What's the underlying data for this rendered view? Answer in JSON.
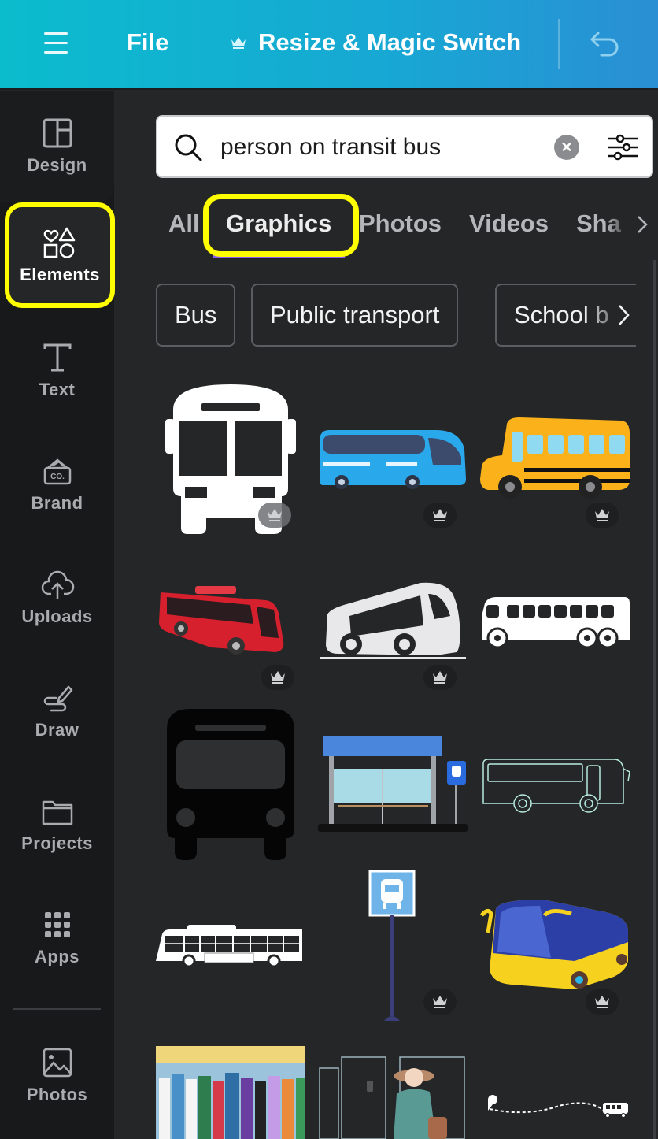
{
  "topbar": {
    "menu_icon": "hamburger-icon",
    "file_label": "File",
    "resize_label": "Resize & Magic Switch",
    "resize_icon": "crown-icon",
    "undo_icon": "undo-icon",
    "gradient_start": "#0bbccd",
    "gradient_end": "#2a8fd4"
  },
  "sidebar": {
    "active": "Elements",
    "highlight_color": "#ffff00",
    "items": [
      {
        "label": "Design",
        "icon": "layout-icon"
      },
      {
        "label": "Elements",
        "icon": "shapes-icon"
      },
      {
        "label": "Text",
        "icon": "text-icon"
      },
      {
        "label": "Brand",
        "icon": "brand-icon"
      },
      {
        "label": "Uploads",
        "icon": "cloud-upload-icon"
      },
      {
        "label": "Draw",
        "icon": "pen-icon"
      },
      {
        "label": "Projects",
        "icon": "folder-icon"
      },
      {
        "label": "Apps",
        "icon": "apps-grid-icon"
      },
      {
        "label": "Photos",
        "icon": "image-icon"
      }
    ]
  },
  "search": {
    "value": "person on transit bus",
    "search_icon": "search-icon",
    "clear_icon": "clear-icon",
    "filter_icon": "filter-sliders-icon"
  },
  "tabs": {
    "active": "Graphics",
    "items": [
      "All",
      "Graphics",
      "Photos",
      "Videos",
      "Shapes"
    ],
    "visible_text": [
      "All",
      "Graphics",
      "Photos",
      "Videos",
      "Sha"
    ]
  },
  "chips": {
    "items": [
      "Bus",
      "Public transport",
      "School bus"
    ],
    "visible_text": [
      "Bus",
      "Public transport",
      "School b"
    ]
  },
  "results": [
    {
      "name": "white-bus-front-silhouette",
      "premium": true
    },
    {
      "name": "blue-coach-bus",
      "premium": true
    },
    {
      "name": "yellow-school-bus",
      "premium": true
    },
    {
      "name": "red-coach-bus",
      "premium": true
    },
    {
      "name": "white-bus-logo-sketch",
      "premium": true
    },
    {
      "name": "white-bus-side-icon",
      "premium": false
    },
    {
      "name": "black-bus-front-icon",
      "premium": false
    },
    {
      "name": "bus-stop-shelter",
      "premium": false
    },
    {
      "name": "bus-outline-line-art",
      "premium": false
    },
    {
      "name": "white-city-bus-side",
      "premium": false
    },
    {
      "name": "bus-stop-sign-pole",
      "premium": true
    },
    {
      "name": "blue-yellow-cartoon-bus",
      "premium": true
    },
    {
      "name": "crowded-bus-passengers",
      "premium": false
    },
    {
      "name": "woman-with-phone-on-transit",
      "premium": false
    },
    {
      "name": "bus-route-map-pin",
      "premium": false
    }
  ]
}
